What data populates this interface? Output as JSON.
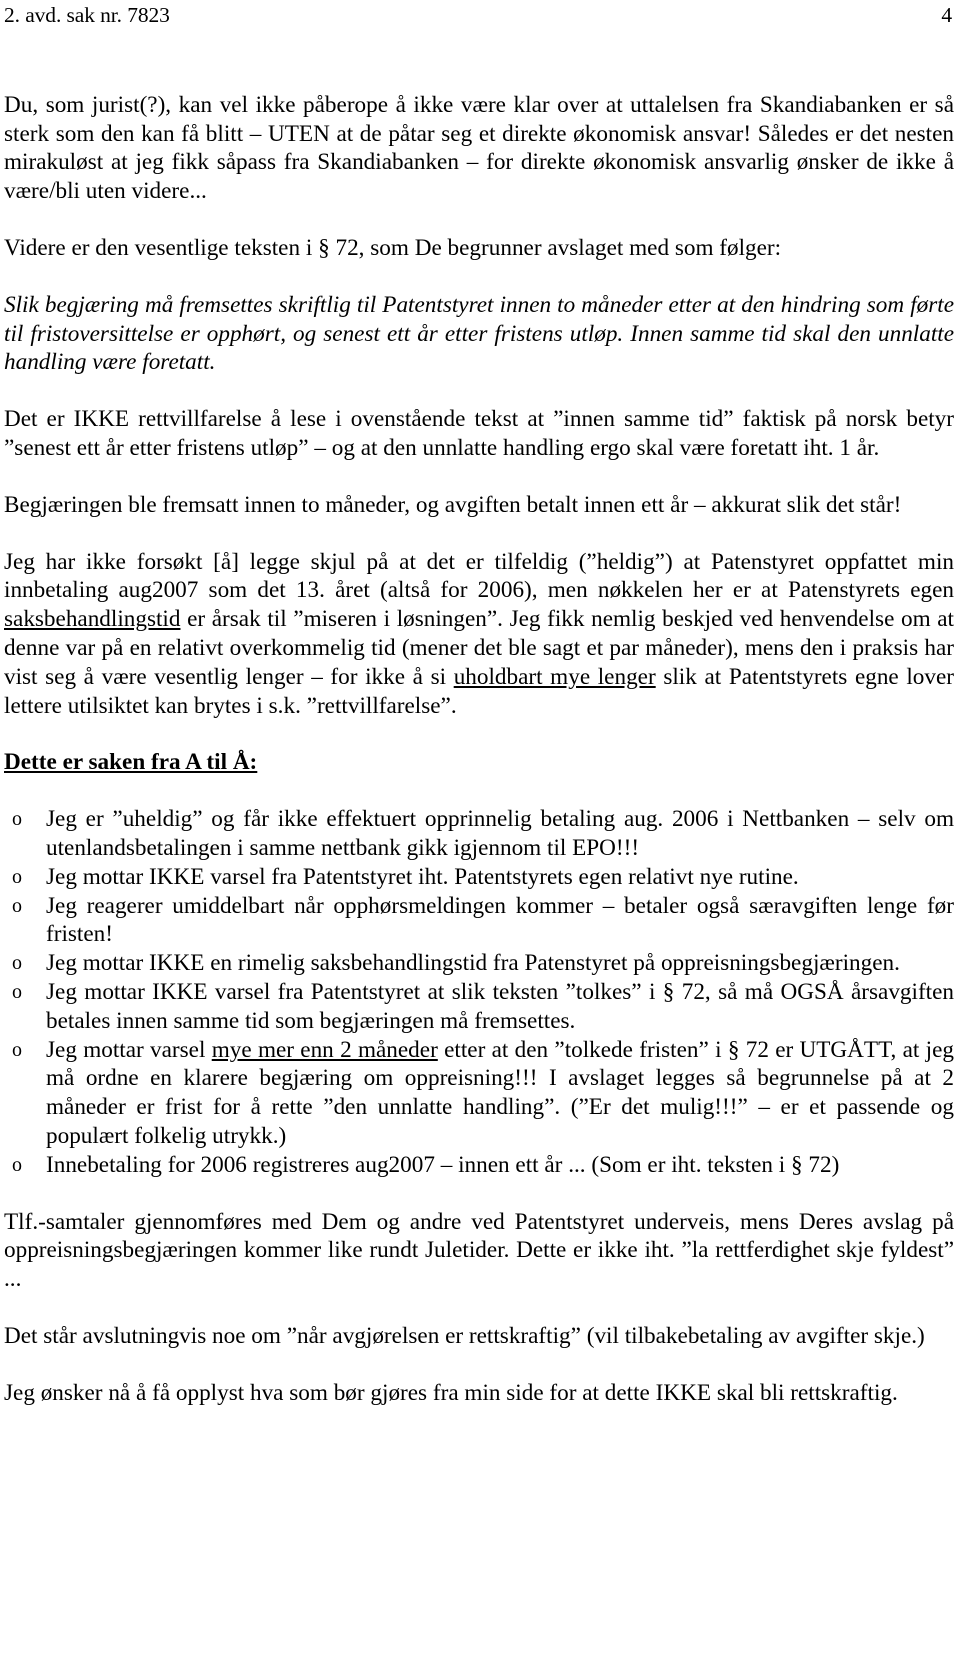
{
  "header": {
    "case_label": "2. avd. sak nr. 7823",
    "page_number": "4"
  },
  "body": {
    "paragraph_1": "Du, som jurist(?), kan vel ikke påberope å ikke være klar over at uttalelsen fra Skandiabanken er så sterk som den kan få blitt – UTEN at de påtar seg et direkte økonomisk ansvar! Således er det nesten mirakuløst at jeg fikk såpass fra Skandiabanken – for direkte økonomisk ansvarlig ønsker de ikke å være/bli uten videre...",
    "paragraph_2": "Videre er den vesentlige teksten i § 72, som De begrunner avslaget med som følger:",
    "quote_1": "Slik begjæring må fremsettes skriftlig til Patentstyret innen to måneder etter at den hindring som førte til fristoversittelse er opphørt, og senest ett år etter fristens utløp. Innen samme tid skal den unnlatte handling være foretatt.",
    "paragraph_3": "Det er IKKE rettvillfarelse å lese i ovenstående tekst at ”innen samme tid” faktisk på norsk betyr ”senest ett år etter fristens utløp” – og at den unnlatte handling ergo skal være foretatt iht. 1 år.",
    "paragraph_4": "Begjæringen ble fremsatt innen to måneder, og avgiften betalt innen ett år – akkurat slik det står!",
    "paragraph_5_part_1": "Jeg har ikke forsøkt [å] legge skjul på at det er tilfeldig (”heldig”) at Patenstyret oppfattet min innbetaling aug2007 som det 13. året (altså for 2006), men nøkkelen her er at Patenstyrets egen ",
    "paragraph_5_underline_1": "saksbehandlingstid",
    "paragraph_5_part_2": " er årsak til ”miseren i løsningen”. Jeg fikk nemlig beskjed ved henvendelse om at denne var på en relativt overkommelig tid (mener det ble sagt et par måneder), mens den i praksis har vist seg å være vesentlig lenger – for ikke å si ",
    "paragraph_5_underline_2": "uholdbart mye lenger",
    "paragraph_5_part_3": " slik at Patentstyrets egne lover lettere utilsiktet kan brytes i s.k. ”rettvillfarelse”.",
    "section_heading": "Dette er saken fra A til Å:",
    "bullet_marker": "o",
    "bullets": [
      {
        "text": "Jeg er ”uheldig” og får ikke effektuert opprinnelig betaling aug. 2006 i Nettbanken – selv om utenlandsbetalingen i samme nettbank gikk igjennom til EPO!!!"
      },
      {
        "text": "Jeg mottar IKKE varsel fra Patentstyret iht. Patentstyrets egen relativt nye rutine."
      },
      {
        "text": "Jeg reagerer umiddelbart når opphørsmeldingen kommer – betaler også særavgiften lenge før fristen!"
      },
      {
        "text": "Jeg mottar IKKE en rimelig saksbehandlingstid fra Patenstyret på oppreisningsbegjæringen."
      },
      {
        "text": "Jeg mottar IKKE varsel fra Patentstyret at slik teksten ”tolkes” i § 72, så må OGSÅ årsavgiften betales innen samme tid som begjæringen må fremsettes."
      },
      {
        "text_part_1": "Jeg mottar varsel ",
        "underline": "mye mer enn 2 måneder",
        "text_part_2": " etter at den ”tolkede fristen” i § 72 er UTGÅTT, at jeg må ordne en klarere begjæring om oppreisning!!! I avslaget legges så begrunnelse på at 2 måneder er frist for å rette ”den unnlatte handling”. (”Er det mulig!!!” – er et passende og populært folkelig utrykk.)"
      },
      {
        "text": "Innebetaling for 2006 registreres aug2007 – innen ett år ... (Som er iht. teksten i § 72)"
      }
    ],
    "paragraph_6": "Tlf.-samtaler gjennomføres med Dem og andre ved Patentstyret underveis, mens Deres avslag på oppreisningsbegjæringen kommer like rundt Juletider. Dette er ikke iht. ”la rettferdighet skje fyldest” ...",
    "paragraph_7": "Det står avslutningvis noe om ”når avgjørelsen er rettskraftig” (vil tilbakebetaling av avgifter skje.)",
    "paragraph_8": "Jeg ønsker nå å få opplyst hva som bør gjøres fra min side for at dette IKKE skal bli rettskraftig."
  }
}
